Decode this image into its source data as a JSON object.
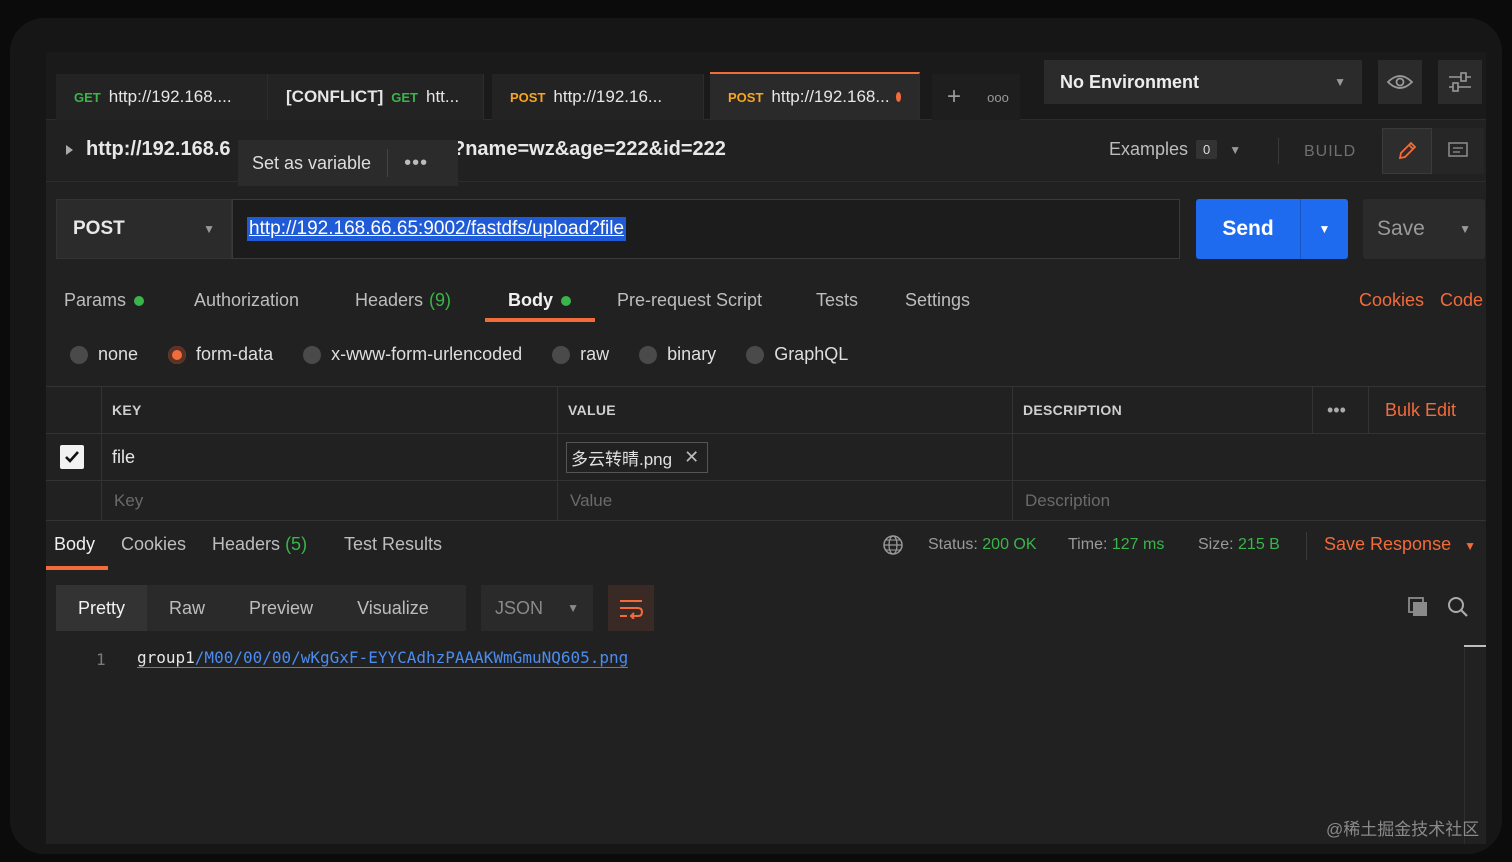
{
  "tabs": [
    {
      "method": "GET",
      "title": "http://192.168...."
    },
    {
      "prefix": "[CONFLICT]",
      "method": "GET",
      "title": "htt..."
    },
    {
      "method": "POST",
      "title": "http://192.16..."
    },
    {
      "method": "POST",
      "title": "http://192.168..."
    }
  ],
  "tab_controls": {
    "add": "+",
    "more": "ooo"
  },
  "environment": {
    "selected": "No Environment"
  },
  "request": {
    "name_start": "http://192.168.6",
    "name_end": "?name=wz&age=222&id=222",
    "tooltip": {
      "action": "Set as variable",
      "more": "•••"
    },
    "examples_label": "Examples",
    "examples_count": "0",
    "build_label": "BUILD",
    "method": "POST",
    "url": "http://192.168.66.65:9002/fastdfs/upload?file",
    "send_label": "Send",
    "save_label": "Save"
  },
  "request_tabs": {
    "params": "Params",
    "authorization": "Authorization",
    "headers": "Headers",
    "headers_count": "(9)",
    "body": "Body",
    "pre_request": "Pre-request Script",
    "tests": "Tests",
    "settings": "Settings",
    "cookies": "Cookies",
    "code": "Code"
  },
  "body_types": {
    "options": [
      "none",
      "form-data",
      "x-www-form-urlencoded",
      "raw",
      "binary",
      "GraphQL"
    ],
    "selected": "form-data"
  },
  "params_table": {
    "headers": {
      "key": "KEY",
      "value": "VALUE",
      "description": "DESCRIPTION",
      "more": "•••",
      "bulk_edit": "Bulk Edit"
    },
    "rows": [
      {
        "checked": true,
        "key": "file",
        "value": "多云转晴.png",
        "remove": "✕"
      }
    ],
    "placeholders": {
      "key": "Key",
      "value": "Value",
      "description": "Description"
    }
  },
  "response": {
    "tabs": {
      "body": "Body",
      "cookies": "Cookies",
      "headers": "Headers",
      "headers_count": "(5)",
      "test_results": "Test Results"
    },
    "status_label": "Status:",
    "status_value": "200 OK",
    "time_label": "Time:",
    "time_value": "127 ms",
    "size_label": "Size:",
    "size_value": "215 B",
    "save_response": "Save Response",
    "views": [
      "Pretty",
      "Raw",
      "Preview",
      "Visualize"
    ],
    "selected_view": "Pretty",
    "format": "JSON",
    "line_number": "1",
    "body_plain": "group1",
    "body_link": "/M00/00/00/wKgGxF-EYYCAdhzPAAAKWmGmuNQ605.png"
  },
  "watermark": "@稀土掘金技术社区",
  "colors": {
    "accent": "#f26b3a",
    "send": "#1f6bf0",
    "success": "#39b54a",
    "get": "#39b54a",
    "post": "#f5a623"
  }
}
